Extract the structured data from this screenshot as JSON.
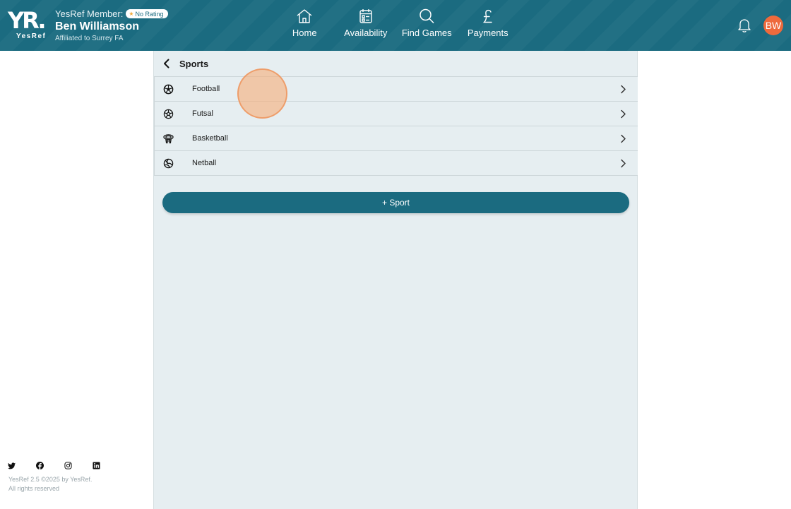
{
  "header": {
    "logo_mark": "YR.",
    "logo_text": "YesRef",
    "member_label": "YesRef Member:",
    "rating_badge": "No Rating",
    "member_name": "Ben Williamson",
    "affiliation": "Affiliated to Surrey FA",
    "avatar_initials": "BW",
    "nav": [
      {
        "label": "Home",
        "icon": "home-icon"
      },
      {
        "label": "Availability",
        "icon": "calendar-icon"
      },
      {
        "label": "Find Games",
        "icon": "search-icon"
      },
      {
        "label": "Payments",
        "icon": "pound-icon"
      }
    ]
  },
  "page": {
    "title": "Sports",
    "sports": [
      {
        "name": "Football",
        "icon": "football-icon"
      },
      {
        "name": "Futsal",
        "icon": "futsal-icon"
      },
      {
        "name": "Basketball",
        "icon": "basketball-icon"
      },
      {
        "name": "Netball",
        "icon": "netball-icon"
      }
    ],
    "add_button": "+ Sport"
  },
  "footer": {
    "socials": [
      "twitter-icon",
      "facebook-icon",
      "instagram-icon",
      "linkedin-icon"
    ],
    "version_line": "YesRef 2.5 ©2025 by YesRef.",
    "rights_line": "All rights reserved"
  },
  "colors": {
    "brand": "#1b6b80",
    "accent": "#ee6a3c",
    "panel_bg": "#e6eef1"
  }
}
